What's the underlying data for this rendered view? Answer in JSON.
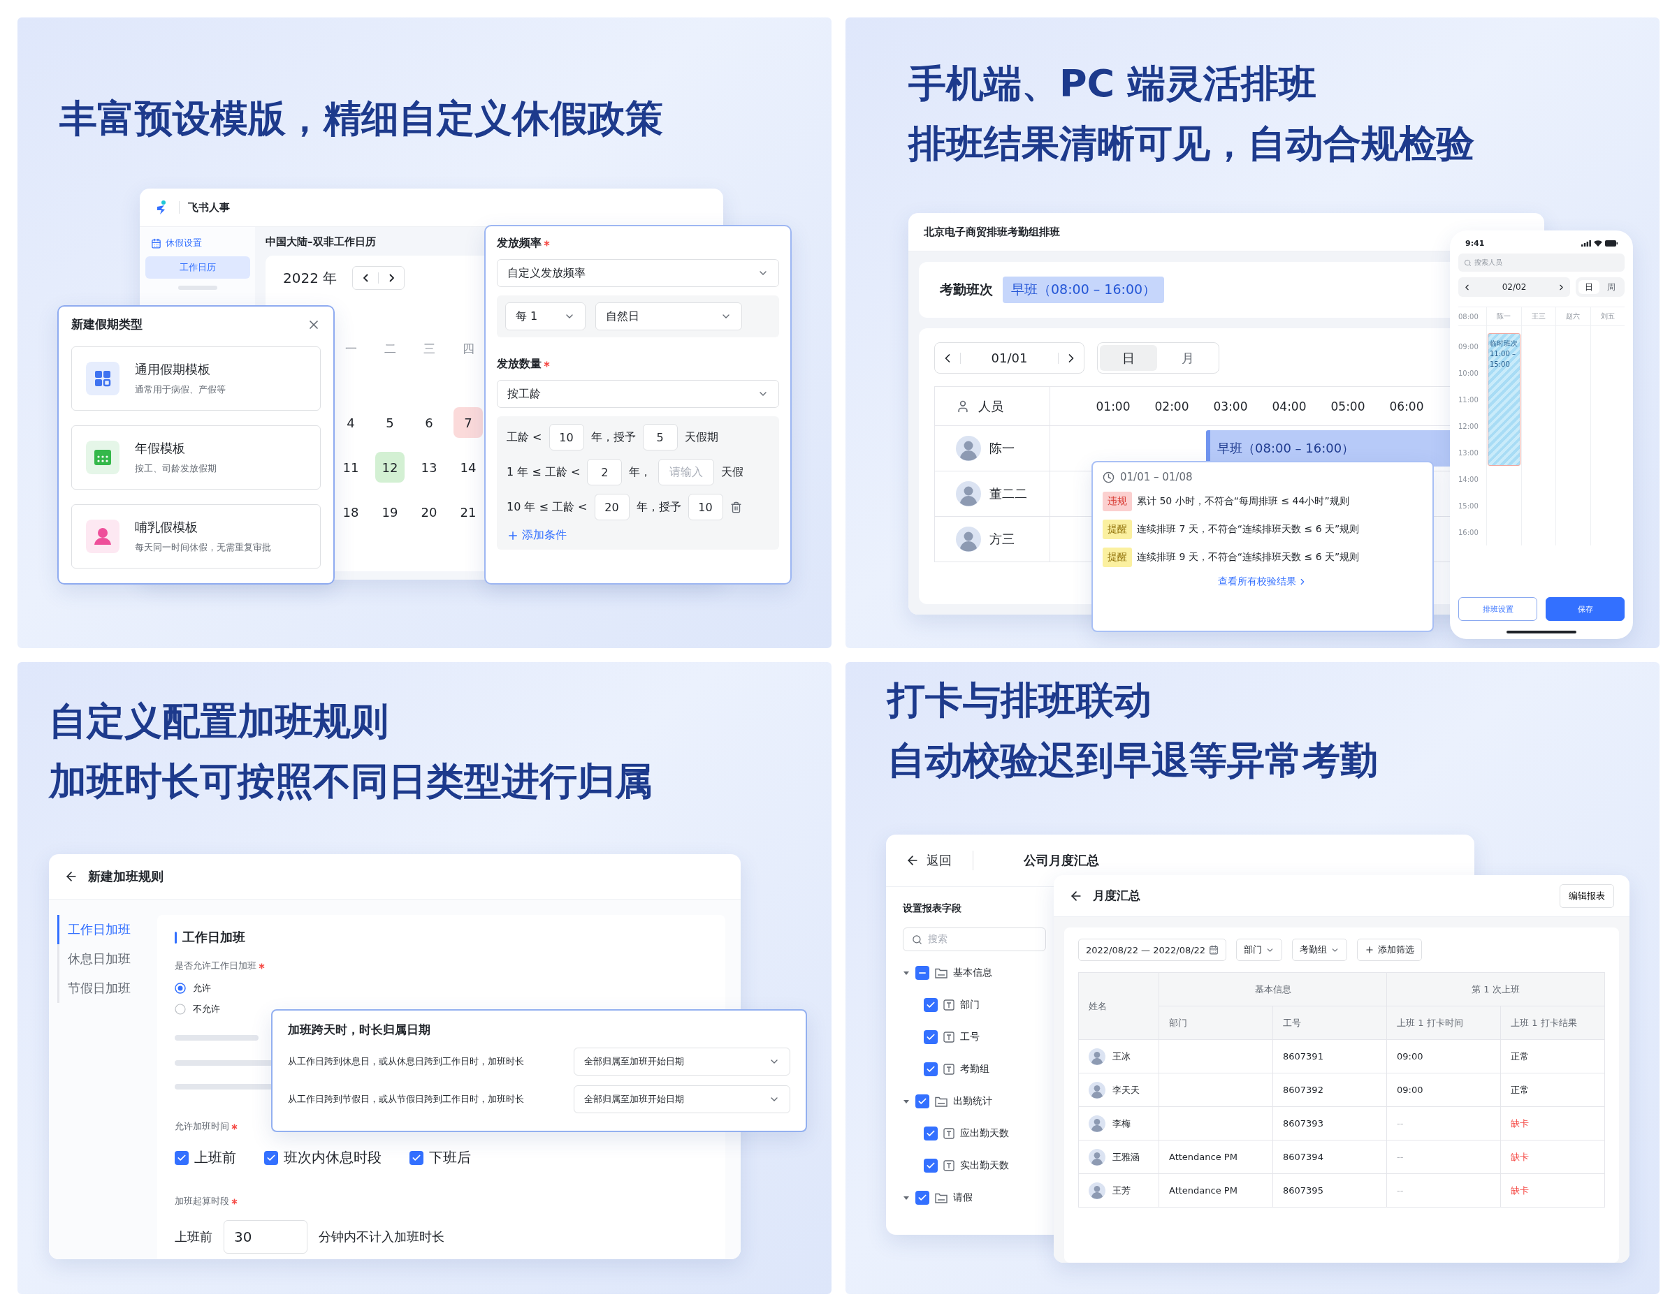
{
  "leave_policy": {
    "headline": [
      "丰富预设模版，精细自定义休假政策"
    ],
    "app": {
      "name": "飞书人事",
      "section": "休假设置",
      "nav": [
        {
          "label": "工作日历",
          "selected": true
        }
      ],
      "calendar_title": "中国大陆–双非工作日历",
      "year": "2022 年",
      "weekdays": [
        "一",
        "二",
        "三",
        "四"
      ],
      "weeks": [
        [
          {
            "day": "4",
            "kind": "normal"
          },
          {
            "day": "5",
            "kind": "normal"
          },
          {
            "day": "6",
            "kind": "normal"
          },
          {
            "day": "7",
            "kind": "holiday"
          }
        ],
        [
          {
            "day": "11",
            "kind": "normal"
          },
          {
            "day": "12",
            "kind": "workday"
          },
          {
            "day": "13",
            "kind": "normal"
          },
          {
            "day": "14",
            "kind": "normal"
          }
        ],
        [
          {
            "day": "18",
            "kind": "normal"
          },
          {
            "day": "19",
            "kind": "normal"
          },
          {
            "day": "20",
            "kind": "normal"
          },
          {
            "day": "21",
            "kind": "normal"
          }
        ]
      ]
    },
    "dialog": {
      "title": "新建假期类型",
      "templates": [
        {
          "name": "通用假期模板",
          "description": "通常用于病假、产假等",
          "kind": "grid",
          "color": "#3f73f0"
        },
        {
          "name": "年假模板",
          "description": "按工、司龄发放假期",
          "kind": "calendar",
          "color": "#34b84a"
        },
        {
          "name": "哺乳假模板",
          "description": "每天同一时间休假，无需重复审批",
          "kind": "person",
          "color": "#ee4f9a"
        }
      ]
    },
    "grant": {
      "frequency_label": {
        "text": "发放频率",
        "required": true
      },
      "frequency": "自定义发放频率",
      "every": "每 1",
      "unit": "自然日",
      "amount_label": {
        "text": "发放数量",
        "required": true
      },
      "amount": "按工龄",
      "rules": [
        {
          "deletable": false,
          "parts": [
            {
              "text": "工龄 <"
            },
            {
              "value": "10"
            },
            {
              "text": "年，授予"
            },
            {
              "value": "5"
            },
            {
              "text": "天假期"
            }
          ]
        },
        {
          "deletable": false,
          "parts": [
            {
              "text": "1 年 ≤ 工龄 <"
            },
            {
              "value": "2"
            },
            {
              "text": "年，"
            },
            {
              "placeholder": "请输入"
            },
            {
              "text": "天假"
            }
          ]
        },
        {
          "deletable": true,
          "parts": [
            {
              "text": "10 年 ≤ 工龄 <"
            },
            {
              "value": "20"
            },
            {
              "text": "年，授予"
            },
            {
              "value": "10"
            }
          ]
        }
      ],
      "add": "添加条件"
    }
  },
  "scheduling": {
    "headline": [
      "手机端、PC 端灵活排班",
      "排班结果清晰可见，自动合规检验"
    ],
    "desktop": {
      "title": "北京电子商贸排班考勤组排班",
      "shift_label": "考勤班次",
      "shift": "早班（08:00 – 16:00）",
      "date": "01/01",
      "views": [
        {
          "label": "日",
          "selected": true
        },
        {
          "label": "月",
          "selected": false
        }
      ],
      "people_header": "人员",
      "hours": [
        "01:00",
        "02:00",
        "03:00",
        "04:00",
        "05:00",
        "06:00"
      ],
      "people": [
        {
          "name": "陈一",
          "shift": "早班（08:00 – 16:00）"
        },
        {
          "name": "董二二"
        },
        {
          "name": "方三"
        }
      ]
    },
    "check": {
      "range": "01/01 – 01/08",
      "issues": [
        {
          "tag": "违规",
          "kind": "violation",
          "text": "累计 50 小时，不符合“每周排班 ≤ 44小时”规则"
        },
        {
          "tag": "提醒",
          "kind": "warning",
          "text": "连续排班 7 天，不符合“连续排班天数 ≤ 6 天”规则"
        },
        {
          "tag": "提醒",
          "kind": "warning",
          "text": "连续排班 9 天，不符合“连续排班天数 ≤ 6 天”规则"
        }
      ],
      "link": "查看所有校验结果"
    },
    "phone": {
      "time": "9:41",
      "search_placeholder": "搜索人员",
      "date": "02/02",
      "views": [
        {
          "label": "日",
          "selected": true
        },
        {
          "label": "周",
          "selected": false
        }
      ],
      "first_hour": "08:00",
      "columns": [
        {
          "name": "陈一",
          "shift": "临时班次 11:00 – 15:00"
        },
        {
          "name": "王三"
        },
        {
          "name": "赵六"
        },
        {
          "name": "刘五"
        }
      ],
      "hours": [
        "09:00",
        "10:00",
        "11:00",
        "12:00",
        "13:00",
        "14:00",
        "15:00",
        "16:00"
      ],
      "buttons": [
        {
          "label": "排班设置",
          "kind": "secondary"
        },
        {
          "label": "保存",
          "kind": "primary"
        }
      ]
    }
  },
  "overtime": {
    "headline": [
      "自定义配置加班规则",
      "加班时长可按照不同日类型进行归属"
    ],
    "window": {
      "title": "新建加班规则",
      "tabs": [
        {
          "label": "工作日加班",
          "selected": true
        },
        {
          "label": "休息日加班",
          "selected": false
        },
        {
          "label": "节假日加班",
          "selected": false
        }
      ],
      "section": "工作日加班",
      "allow_label": {
        "text": "是否允许工作日加班",
        "required": true
      },
      "options": [
        {
          "label": "允许",
          "selected": true
        },
        {
          "label": "不允许",
          "selected": false
        }
      ],
      "time_label": {
        "text": "允许加班时间",
        "required": true
      },
      "times": [
        {
          "label": "上班前",
          "checked": true
        },
        {
          "label": "班次内休息时段",
          "checked": true
        },
        {
          "label": "下班后",
          "checked": true
        }
      ],
      "start_label": {
        "text": "加班起算时段",
        "required": true
      },
      "start_prefix": "上班前",
      "start_value": "30",
      "start_suffix": "分钟内不计入加班时长"
    },
    "cross_day": {
      "title": "加班跨天时，时长归属日期",
      "rows": [
        {
          "label": "从工作日跨到休息日，或从休息日跨到工作日时，加班时长",
          "value": "全部归属至加班开始日期"
        },
        {
          "label": "从工作日跨到节假日，或从节假日跨到工作日时，加班时长",
          "value": "全部归属至加班开始日期"
        }
      ]
    }
  },
  "attendance": {
    "headline": [
      "打卡与排班联动",
      "自动校验迟到早退等异常考勤"
    ],
    "fields": {
      "back": "返回",
      "title": "公司月度汇总",
      "pane_title": "设置报表字段",
      "search_placeholder": "搜索",
      "tree": [
        {
          "label": "基本信息",
          "kind": "folder",
          "expanded": true,
          "indeterminate": true,
          "children": [
            {
              "label": "部门",
              "kind": "text",
              "checked": true
            },
            {
              "label": "工号",
              "kind": "text",
              "checked": true
            },
            {
              "label": "考勤组",
              "kind": "text",
              "checked": true
            }
          ]
        },
        {
          "label": "出勤统计",
          "kind": "folder",
          "expanded": true,
          "checked": true,
          "children": [
            {
              "label": "应出勤天数",
              "kind": "text",
              "checked": true
            },
            {
              "label": "实出勤天数",
              "kind": "text",
              "checked": true
            }
          ]
        },
        {
          "label": "请假",
          "kind": "folder",
          "expanded": true,
          "checked": true
        }
      ]
    },
    "report": {
      "title": "月度汇总",
      "edit": "编辑报表",
      "date_range": "2022/08/22 — 2022/08/22",
      "filters": [
        {
          "label": "部门",
          "kind": "dropdown"
        },
        {
          "label": "考勤组",
          "kind": "dropdown"
        },
        {
          "label": "添加筛选",
          "kind": "add"
        }
      ],
      "name_header": "姓名",
      "groups": [
        {
          "label": "基本信息",
          "columns": [
            "部门",
            "工号"
          ]
        },
        {
          "label": "第 1 次上班",
          "columns": [
            "上班 1 打卡时间",
            "上班 1 打卡结果"
          ]
        }
      ],
      "rows": [
        {
          "name": "王冰",
          "employee_id": "8607391",
          "clock_in": "09:00",
          "result": "正常",
          "kind": "normal"
        },
        {
          "name": "李天天",
          "employee_id": "8607392",
          "clock_in": "09:00",
          "result": "正常",
          "kind": "normal"
        },
        {
          "name": "李梅",
          "employee_id": "8607393",
          "clock_in": "--",
          "result": "缺卡",
          "kind": "missing"
        },
        {
          "name": "王雅涵",
          "department": "Attendance PM",
          "employee_id": "8607394",
          "clock_in": "--",
          "result": "缺卡",
          "kind": "missing"
        },
        {
          "name": "王芳",
          "department": "Attendance PM",
          "employee_id": "8607395",
          "clock_in": "--",
          "result": "缺卡",
          "kind": "missing"
        }
      ]
    }
  }
}
